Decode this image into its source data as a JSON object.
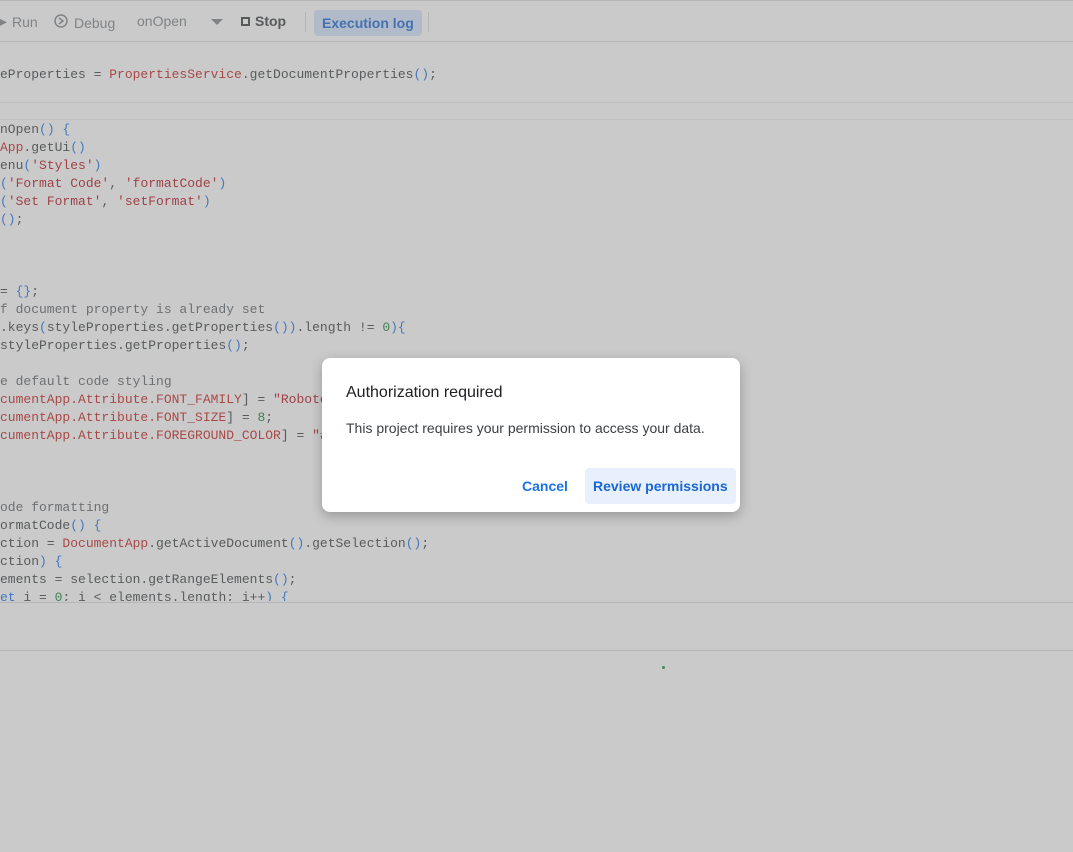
{
  "toolbar": {
    "run_label": "Run",
    "debug_label": "Debug",
    "function_select": "onOpen",
    "stop_label": "Stop",
    "execution_log_label": "Execution log"
  },
  "code_lines": [
    {
      "parts": [
        [
          "",
          "eProperties = "
        ],
        [
          "cls",
          "PropertiesService"
        ],
        [
          "",
          ".getDocumentProperties"
        ],
        [
          "kw",
          "()"
        ],
        [
          "",
          ";"
        ]
      ]
    },
    {
      "parts": [
        [
          "",
          "nOpen"
        ],
        [
          "kw",
          "()"
        ],
        [
          "kw",
          " {"
        ]
      ]
    },
    {
      "parts": [
        [
          "cls",
          "App"
        ],
        [
          "",
          ".getUi"
        ],
        [
          "kw",
          "()"
        ]
      ]
    },
    {
      "parts": [
        [
          "",
          "enu"
        ],
        [
          "kw",
          "("
        ],
        [
          "str",
          "'Styles'"
        ],
        [
          "kw",
          ")"
        ]
      ]
    },
    {
      "parts": [
        [
          "kw",
          "("
        ],
        [
          "str",
          "'Format Code'"
        ],
        [
          "",
          ", "
        ],
        [
          "str",
          "'formatCode'"
        ],
        [
          "kw",
          ")"
        ]
      ]
    },
    {
      "parts": [
        [
          "kw",
          "("
        ],
        [
          "str",
          "'Set Format'"
        ],
        [
          "",
          ", "
        ],
        [
          "str",
          "'setFormat'"
        ],
        [
          "kw",
          ")"
        ]
      ]
    },
    {
      "parts": [
        [
          "kw",
          "()"
        ],
        [
          "",
          ";"
        ]
      ]
    },
    {
      "parts": [
        [
          "",
          "= "
        ],
        [
          "kw",
          "{}"
        ],
        [
          "",
          ";"
        ]
      ]
    },
    {
      "parts": [
        [
          "cmt",
          "f document property is already set"
        ]
      ]
    },
    {
      "parts": [
        [
          "",
          ".keys"
        ],
        [
          "kw",
          "("
        ],
        [
          "",
          "styleProperties.getProperties"
        ],
        [
          "kw",
          "())"
        ],
        [
          "",
          ".length != "
        ],
        [
          "num",
          "0"
        ],
        [
          "kw",
          "){"
        ]
      ]
    },
    {
      "parts": [
        [
          "",
          "styleProperties.getProperties"
        ],
        [
          "kw",
          "()"
        ],
        [
          "",
          ";"
        ]
      ]
    },
    {
      "parts": [
        [
          "cmt",
          "e default code styling"
        ]
      ]
    },
    {
      "parts": [
        [
          "cls",
          "cumentApp.Attribute.FONT_FAMILY"
        ],
        [
          "",
          "] = "
        ],
        [
          "str",
          "\"Roboto"
        ]
      ]
    },
    {
      "parts": [
        [
          "cls",
          "cumentApp.Attribute.FONT_SIZE"
        ],
        [
          "",
          "] = "
        ],
        [
          "num",
          "8"
        ],
        [
          "",
          ";"
        ]
      ]
    },
    {
      "parts": [
        [
          "cls",
          "cumentApp.Attribute.FOREGROUND_COLOR"
        ],
        [
          "",
          "] = "
        ],
        [
          "str",
          "\"#"
        ]
      ]
    },
    {
      "parts": [
        [
          "cmt",
          "ode formatting"
        ]
      ]
    },
    {
      "parts": [
        [
          "",
          "ormatCode"
        ],
        [
          "kw",
          "()"
        ],
        [
          "kw",
          " {"
        ]
      ]
    },
    {
      "parts": [
        [
          "",
          "ction = "
        ],
        [
          "cls",
          "DocumentApp"
        ],
        [
          "",
          ".getActiveDocument"
        ],
        [
          "kw",
          "()"
        ],
        [
          "",
          ".getSelection"
        ],
        [
          "kw",
          "()"
        ],
        [
          "",
          ";"
        ]
      ]
    },
    {
      "parts": [
        [
          "",
          "ction"
        ],
        [
          "kw",
          ")"
        ],
        [
          "kw",
          " {"
        ]
      ]
    },
    {
      "parts": [
        [
          "",
          "ements = selection.getRangeElements"
        ],
        [
          "kw",
          "()"
        ],
        [
          "",
          ";"
        ]
      ]
    },
    {
      "parts": [
        [
          "kw",
          "et"
        ],
        [
          "",
          " i = "
        ],
        [
          "num",
          "0"
        ],
        [
          "",
          "; i < elements.length; i++"
        ],
        [
          "kw",
          ")"
        ],
        [
          "kw",
          " {"
        ]
      ]
    }
  ],
  "dialog": {
    "title": "Authorization required",
    "body": "This project requires your permission to access your data.",
    "cancel_label": "Cancel",
    "review_label": "Review permissions"
  },
  "colors": {
    "accent": "#1a73e8",
    "string": "#b5131c",
    "class": "#c5221f",
    "number": "#188038"
  }
}
